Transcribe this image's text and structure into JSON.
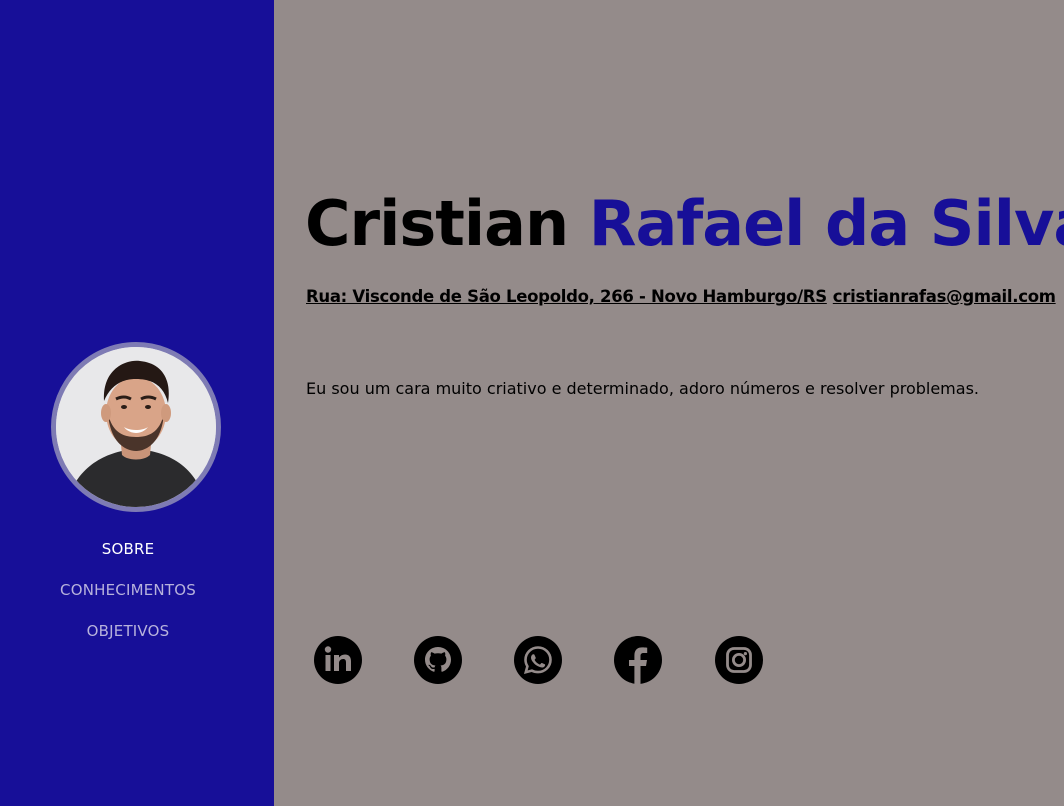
{
  "colors": {
    "sidebar_bg": "#170f98",
    "main_bg": "#948b8a",
    "accent": "#170f98",
    "text": "#000000"
  },
  "profile": {
    "avatar_icon": "profile-photo"
  },
  "nav": {
    "items": [
      {
        "label": "SOBRE",
        "active": true
      },
      {
        "label": "CONHECIMENTOS",
        "active": false
      },
      {
        "label": "OBJETIVOS",
        "active": false
      }
    ]
  },
  "header": {
    "first_name": "Cristian",
    "last_name": "Rafael da Silva",
    "address": "Rua: Visconde de São Leopoldo, 266 - Novo Hamburgo/RS",
    "email": "cristianrafas@gmail.com"
  },
  "about": {
    "text": "Eu sou um cara muito criativo e determinado, adoro números e resolver problemas."
  },
  "social": [
    {
      "name": "linkedin",
      "icon": "linkedin-icon"
    },
    {
      "name": "github",
      "icon": "github-icon"
    },
    {
      "name": "whatsapp",
      "icon": "whatsapp-icon"
    },
    {
      "name": "facebook",
      "icon": "facebook-icon"
    },
    {
      "name": "instagram",
      "icon": "instagram-icon"
    }
  ]
}
